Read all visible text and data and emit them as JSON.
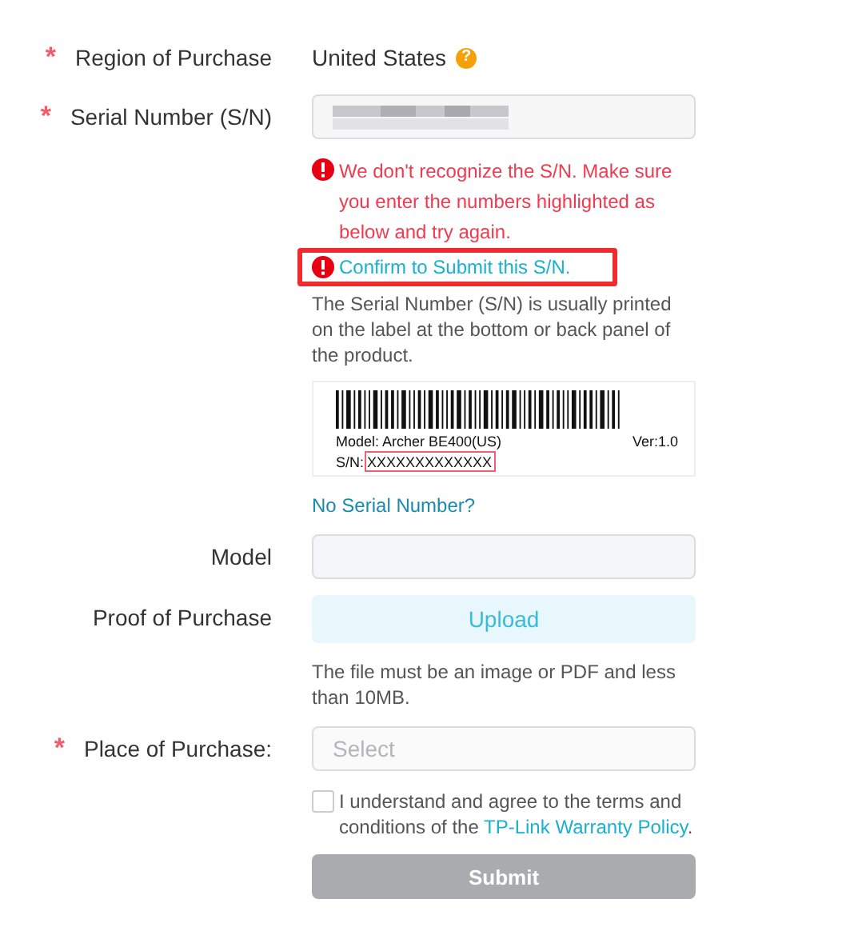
{
  "region": {
    "label": "Region of Purchase",
    "required_mark": "*",
    "value": "United States",
    "help": "?"
  },
  "serial": {
    "label": "Serial Number (S/N)",
    "required_mark": "*",
    "value_obscured": true,
    "error": "We don't recognize the S/N. Make sure you enter the numbers highlighted as below and try again.",
    "confirm_link": "Confirm to Submit this S/N.",
    "confirm_highlighted": true,
    "hint": "The Serial Number (S/N) is usually printed on the label at the bottom or back panel of the product.",
    "sample_label": {
      "model": "Model: Archer BE400(US)",
      "version": "Ver:1.0",
      "sn_prefix": "S/N:",
      "sn_value": "XXXXXXXXXXXXX"
    },
    "no_serial_link": "No Serial Number?"
  },
  "model": {
    "label": "Model"
  },
  "proof": {
    "label": "Proof of Purchase",
    "button": "Upload",
    "hint": "The file must be an image or PDF and less than 10MB."
  },
  "place": {
    "label": "Place of Purchase:",
    "required_mark": "*",
    "placeholder": "Select"
  },
  "agreement": {
    "checked": false,
    "text": "I understand and agree to the terms and conditions of the ",
    "link": "TP-Link Warranty Policy",
    "end": "."
  },
  "submit": {
    "label": "Submit",
    "disabled": true
  }
}
